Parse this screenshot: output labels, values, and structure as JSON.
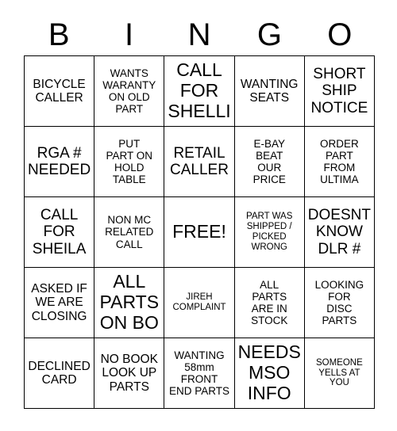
{
  "card": {
    "header_letters": [
      "B",
      "I",
      "N",
      "G",
      "O"
    ],
    "cells": [
      {
        "text": "BICYCLE\nCALLER",
        "size": "md"
      },
      {
        "text": "WANTS\nWARANTY\nON OLD\nPART",
        "size": "sm"
      },
      {
        "text": "CALL\nFOR\nSHELLI",
        "size": "xl"
      },
      {
        "text": "WANTING\nSEATS",
        "size": "md"
      },
      {
        "text": "SHORT\nSHIP\nNOTICE",
        "size": "lg"
      },
      {
        "text": "RGA #\nNEEDED",
        "size": "lg"
      },
      {
        "text": "PUT\nPART ON\nHOLD\nTABLE",
        "size": "sm"
      },
      {
        "text": "RETAIL\nCALLER",
        "size": "lg"
      },
      {
        "text": "E-BAY\nBEAT\nOUR\nPRICE",
        "size": "sm"
      },
      {
        "text": "ORDER\nPART\nFROM\nULTIMA",
        "size": "sm"
      },
      {
        "text": "CALL\nFOR\nSHEILA",
        "size": "lg"
      },
      {
        "text": "NON MC\nRELATED\nCALL",
        "size": "sm"
      },
      {
        "text": "FREE!",
        "size": "xl"
      },
      {
        "text": "PART WAS\nSHIPPED /\nPICKED\nWRONG",
        "size": "xs"
      },
      {
        "text": "DOESNT\nKNOW\nDLR #",
        "size": "lg"
      },
      {
        "text": "ASKED IF\nWE ARE\nCLOSING",
        "size": "md"
      },
      {
        "text": "ALL\nPARTS\nON BO",
        "size": "xl"
      },
      {
        "text": "JIREH\nCOMPLAINT",
        "size": "xs"
      },
      {
        "text": "ALL\nPARTS\nARE IN\nSTOCK",
        "size": "sm"
      },
      {
        "text": "LOOKING\nFOR\nDISC\nPARTS",
        "size": "sm"
      },
      {
        "text": "DECLINED\nCARD",
        "size": "md"
      },
      {
        "text": "NO BOOK\nLOOK UP\nPARTS",
        "size": "md"
      },
      {
        "text": "WANTING\n58mm\nFRONT\nEND PARTS",
        "size": "sm"
      },
      {
        "text": "NEEDS\nMSO\nINFO",
        "size": "xl"
      },
      {
        "text": "SOMEONE\nYELLS AT\nYOU",
        "size": "xs"
      }
    ]
  },
  "colors": {
    "border": "#000000",
    "background": "#ffffff",
    "text": "#000000"
  }
}
